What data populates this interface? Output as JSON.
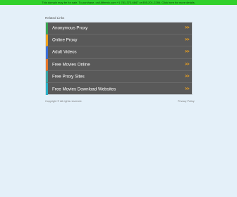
{
  "banner": {
    "text": "This domain may be for sale. To purchase, call Afternic.com +1 781-373-6847 or 855-201-2286. Click here for more details.",
    "color": "#31d12c"
  },
  "related": {
    "title": "Related Links"
  },
  "links": [
    {
      "label": "Anonymous Proxy",
      "chevron": ">>",
      "accent": "#3aa655"
    },
    {
      "label": "Online Proxy",
      "chevron": ">>",
      "accent": "#f0a21c"
    },
    {
      "label": "Adult Videos",
      "chevron": ">>",
      "accent": "#3a6fd8"
    },
    {
      "label": "Free Movies Online",
      "chevron": ">>",
      "accent": "#e8772b"
    },
    {
      "label": "Free Proxy Sites",
      "chevron": ">>",
      "accent": "#3aa6a6"
    },
    {
      "label": "Free Movies Download Websites",
      "chevron": ">>",
      "accent": "#2bb0c8"
    }
  ],
  "footer": {
    "copyright": "Copyright © All rights reserved.",
    "privacy": "Privacy Policy"
  }
}
